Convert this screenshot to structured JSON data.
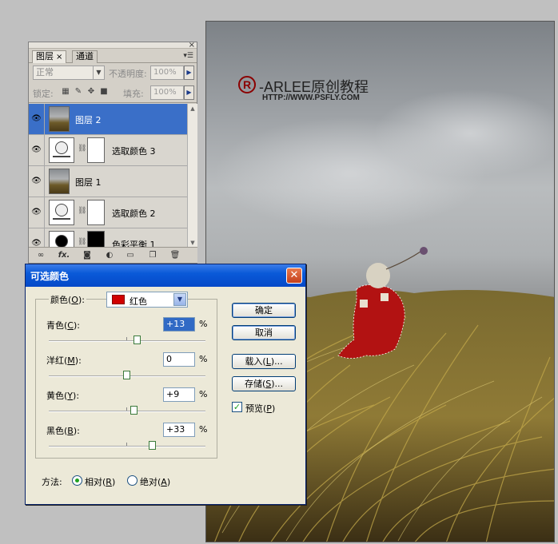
{
  "watermark": {
    "symbol": "R",
    "title": "-ARLEE原创教程",
    "url": "HTTP://WWW.PSFLY.COM"
  },
  "layers_panel": {
    "tabs": [
      {
        "label": "图层"
      },
      {
        "label": "通道"
      }
    ],
    "tab_close": "×",
    "blend_mode": "正常",
    "opacity_label": "不透明度:",
    "opacity_value": "100%",
    "lock_label": "锁定:",
    "fill_label": "填充:",
    "fill_value": "100%",
    "layers": [
      {
        "name": "图层 2",
        "selected": true
      },
      {
        "name": "选取颜色 3"
      },
      {
        "name": "图层 1"
      },
      {
        "name": "选取颜色 2"
      },
      {
        "name": "色彩平衡 1"
      }
    ],
    "bottom_icons": [
      "link-icon",
      "fx-icon",
      "mask-icon",
      "adjustment-icon",
      "folder-icon",
      "new-layer-icon",
      "trash-icon"
    ],
    "fx_label": "fx."
  },
  "dialog": {
    "title": "可选颜色",
    "colors_label": "颜色(",
    "colors_key": "O",
    "colors_selected": "红色",
    "sliders": [
      {
        "label": "青色(",
        "key": "C",
        "value": "+13",
        "percent": 13
      },
      {
        "label": "洋红(",
        "key": "M",
        "value": "0",
        "percent": 0
      },
      {
        "label": "黄色(",
        "key": "Y",
        "value": "+9",
        "percent": 9
      },
      {
        "label": "黑色(",
        "key": "B",
        "value": "+33",
        "percent": 33
      }
    ],
    "pct_sign": "%",
    "buttons": {
      "ok": "确定",
      "cancel": "取消",
      "load_prefix": "载入(",
      "load_key": "L",
      "load_suffix": ")...",
      "save_prefix": "存储(",
      "save_key": "S",
      "save_suffix": ")..."
    },
    "preview_prefix": "预览(",
    "preview_key": "P",
    "method_label": "方法:",
    "method_relative_prefix": "相对(",
    "method_relative_key": "R",
    "method_absolute_prefix": "绝对(",
    "method_absolute_key": "A",
    "method_selected": "relative"
  }
}
